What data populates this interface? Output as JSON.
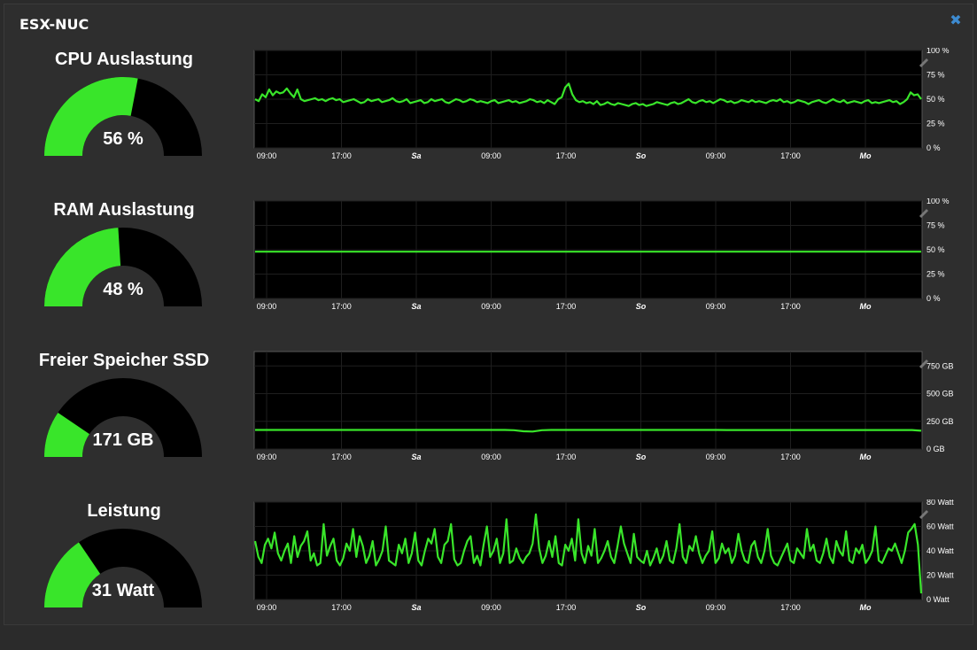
{
  "panel": {
    "title": "ESX-NUC",
    "close_icon": "close-icon"
  },
  "x_labels": [
    "09:00",
    "17:00",
    "Sa",
    "09:00",
    "17:00",
    "So",
    "09:00",
    "17:00",
    "Mo"
  ],
  "x_label_italic": [
    false,
    false,
    true,
    false,
    false,
    true,
    false,
    false,
    true
  ],
  "colors": {
    "accent": "#39e52a",
    "gauge_bg": "#000000",
    "plot_bg": "#000000",
    "grid": "#1e1e1e"
  },
  "rows": [
    {
      "title": "CPU Auslastung",
      "value_label": "56 %",
      "gauge_fraction": 0.56,
      "chart_data": {
        "type": "line",
        "y_ticks": [
          "100 %",
          "75 %",
          "50 %",
          "25 %",
          "0 %"
        ],
        "ylim": [
          0,
          100
        ],
        "values": [
          50,
          48,
          55,
          52,
          60,
          54,
          58,
          56,
          57,
          61,
          56,
          52,
          60,
          50,
          48,
          49,
          50,
          51,
          49,
          50,
          48,
          50,
          51,
          49,
          50,
          47,
          48,
          49,
          50,
          48,
          46,
          47,
          50,
          48,
          49,
          50,
          47,
          48,
          49,
          51,
          48,
          47,
          48,
          50,
          46,
          47,
          48,
          49,
          46,
          47,
          50,
          48,
          49,
          50,
          47,
          46,
          48,
          50,
          49,
          47,
          48,
          50,
          49,
          47,
          48,
          47,
          46,
          48,
          49,
          46,
          47,
          48,
          49,
          47,
          48,
          46,
          47,
          48,
          50,
          49,
          47,
          48,
          46,
          49,
          47,
          45,
          50,
          52,
          62,
          66,
          55,
          49,
          47,
          48,
          46,
          47,
          45,
          48,
          44,
          45,
          47,
          45,
          44,
          46,
          45,
          44,
          43,
          45,
          46,
          44,
          45,
          43,
          44,
          45,
          47,
          46,
          45,
          44,
          46,
          47,
          45,
          46,
          48,
          50,
          47,
          46,
          48,
          49,
          47,
          48,
          46,
          48,
          50,
          49,
          47,
          48,
          46,
          47,
          49,
          48,
          47,
          49,
          47,
          48,
          47,
          46,
          48,
          49,
          48,
          50,
          47,
          48,
          46,
          47,
          49,
          48,
          47,
          45,
          47,
          48,
          49,
          47,
          46,
          48,
          50,
          48,
          47,
          49,
          46,
          47,
          48,
          47,
          46,
          48,
          49,
          46,
          47,
          46,
          47,
          48,
          49,
          47,
          48,
          45,
          47,
          50,
          57,
          54,
          55,
          50
        ]
      }
    },
    {
      "title": "RAM Auslastung",
      "value_label": "48 %",
      "gauge_fraction": 0.48,
      "chart_data": {
        "type": "line",
        "y_ticks": [
          "100 %",
          "75 %",
          "50 %",
          "25 %",
          "0 %"
        ],
        "ylim": [
          0,
          100
        ],
        "values": [
          48,
          48,
          48,
          48,
          48,
          48,
          48,
          48,
          48,
          48,
          48,
          48,
          48,
          48,
          48,
          48,
          48,
          48,
          48,
          48
        ]
      }
    },
    {
      "title": "Freier Speicher SSD",
      "value_label": "171 GB",
      "gauge_fraction": 0.19,
      "chart_data": {
        "type": "line",
        "y_ticks": [
          "750 GB",
          "500 GB",
          "250 GB",
          "0 GB"
        ],
        "ylim": [
          0,
          880
        ],
        "values": [
          172,
          172,
          172,
          172,
          172,
          172,
          172,
          172,
          172,
          172,
          172,
          172,
          172,
          172,
          172,
          172,
          172,
          172,
          172,
          172,
          172,
          172,
          172,
          172,
          172,
          172,
          172,
          172,
          170,
          160,
          158,
          170,
          172,
          172,
          172,
          172,
          172,
          172,
          172,
          172,
          172,
          172,
          172,
          172,
          172,
          172,
          172,
          172,
          172,
          172,
          172,
          171,
          171,
          171,
          171,
          171,
          171,
          171,
          171,
          171,
          171,
          171,
          171,
          171,
          171,
          171,
          171,
          171,
          171,
          171,
          171,
          171,
          165
        ]
      }
    },
    {
      "title": "Leistung",
      "value_label": "31 Watt",
      "gauge_fraction": 0.31,
      "chart_data": {
        "type": "line",
        "y_ticks": [
          "80 Watt",
          "60 Watt",
          "40 Watt",
          "20 Watt",
          "0 Watt"
        ],
        "ylim": [
          0,
          80
        ],
        "values": [
          48,
          35,
          30,
          45,
          50,
          42,
          55,
          38,
          32,
          40,
          46,
          30,
          52,
          35,
          44,
          48,
          56,
          32,
          38,
          28,
          30,
          62,
          36,
          44,
          50,
          32,
          28,
          34,
          46,
          40,
          58,
          35,
          52,
          44,
          30,
          36,
          48,
          28,
          33,
          40,
          60,
          32,
          30,
          28,
          45,
          38,
          50,
          30,
          38,
          55,
          32,
          28,
          40,
          50,
          46,
          58,
          35,
          30,
          45,
          48,
          62,
          33,
          28,
          30,
          40,
          48,
          52,
          30,
          36,
          28,
          45,
          60,
          35,
          40,
          50,
          30,
          38,
          66,
          30,
          32,
          42,
          34,
          30,
          35,
          38,
          46,
          70,
          42,
          30,
          36,
          48,
          35,
          52,
          30,
          28,
          45,
          40,
          50,
          32,
          66,
          38,
          30,
          44,
          36,
          58,
          30,
          34,
          40,
          48,
          35,
          30,
          44,
          60,
          46,
          38,
          30,
          54,
          35,
          32,
          30,
          40,
          28,
          34,
          42,
          30,
          36,
          48,
          32,
          30,
          42,
          62,
          35,
          30,
          44,
          40,
          52,
          38,
          30,
          36,
          40,
          56,
          30,
          34,
          46,
          38,
          42,
          30,
          36,
          54,
          40,
          32,
          30,
          44,
          48,
          35,
          30,
          40,
          58,
          36,
          30,
          28,
          34,
          40,
          46,
          32,
          30,
          42,
          38,
          34,
          58,
          40,
          45,
          32,
          30,
          38,
          50,
          35,
          30,
          48,
          40,
          36,
          56,
          32,
          30,
          42,
          38,
          45,
          30,
          34,
          40,
          60,
          32,
          30,
          36,
          42,
          40,
          46,
          38,
          30,
          40,
          55,
          58,
          62,
          45,
          5
        ]
      }
    }
  ]
}
